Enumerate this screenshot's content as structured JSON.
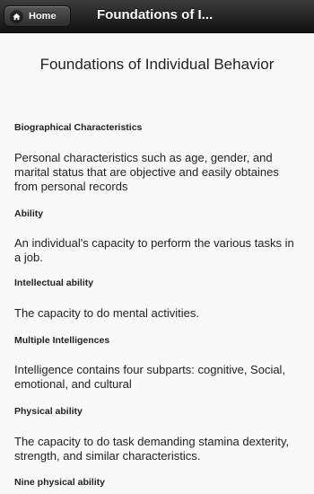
{
  "header": {
    "home_label": "Home",
    "title": "Foundations of I..."
  },
  "page": {
    "title": "Foundations of Individual Behavior"
  },
  "sections": [
    {
      "heading": "Biographical Characteristics",
      "text": "Personal characteristics such as age, gender, and marital status that are objective and easily obtaines from personal records"
    },
    {
      "heading": "Ability",
      "text": "An individual's capacity to perform the various tasks in a job."
    },
    {
      "heading": "Intellectual ability",
      "text": "The capacity to do mental activities."
    },
    {
      "heading": "Multiple Intelligences",
      "text": "Intelligence contains four subparts: cognitive, Social, emotional, and cultural"
    },
    {
      "heading": "Physical ability",
      "text": "The capacity to do task demanding stamina dexterity, strength, and similar characteristics."
    },
    {
      "heading": "Nine physical ability"
    }
  ]
}
